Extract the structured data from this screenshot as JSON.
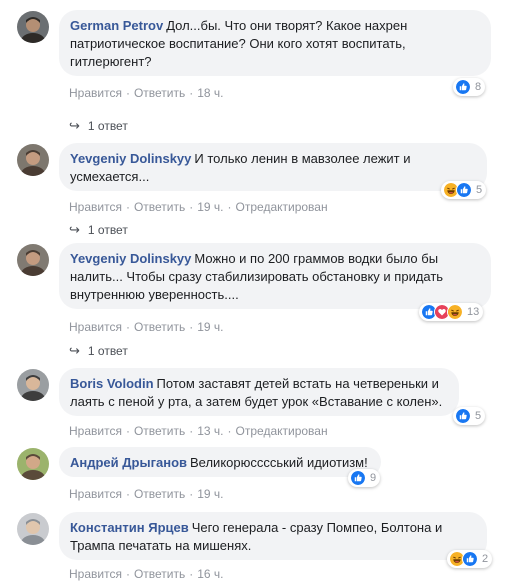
{
  "colors": {
    "link": "#385898",
    "bubble": "#f2f3f5",
    "meta": "#90949c",
    "like": "#1877f2",
    "love": "#e7415a",
    "haha": "#f7b125"
  },
  "comments": [
    {
      "author": "German Petrov",
      "text": "Дол...бы. Что они творят? Какое нахрен патриотическое воспитание? Они кого хотят воспитать, гитлерюгент?",
      "like": "Нравится",
      "reply": "Ответить",
      "time": "18 ч.",
      "edited": "",
      "reactions": [
        "like"
      ],
      "count": "8",
      "replies": "1 ответ"
    },
    {
      "author": "Yevgeniy Dolinskyy",
      "text": "И только ленин в мавзолее лежит и усмехается...",
      "like": "Нравится",
      "reply": "Ответить",
      "time": "19 ч.",
      "edited": "Отредактирован",
      "reactions": [
        "haha",
        "like"
      ],
      "count": "5",
      "replies": "1 ответ"
    },
    {
      "author": "Yevgeniy Dolinskyy",
      "text": "Можно и по 200 граммов водки было бы налить... Чтобы сразу стабилизировать обстановку и придать внутреннюю уверенность....",
      "like": "Нравится",
      "reply": "Ответить",
      "time": "19 ч.",
      "edited": "",
      "reactions": [
        "like",
        "love",
        "haha"
      ],
      "count": "13",
      "replies": "1 ответ"
    },
    {
      "author": "Boris Volodin",
      "text": "Потом заставят детей встать на четвереньки и лаять с пеной у рта, а затем будет урок «Вставание с колен».",
      "like": "Нравится",
      "reply": "Ответить",
      "time": "13 ч.",
      "edited": "Отредактирован",
      "reactions": [
        "like"
      ],
      "count": "5",
      "replies": ""
    },
    {
      "author": "Андрей Дрыганов",
      "text": "Великорюсссський идиотизм!",
      "like": "Нравится",
      "reply": "Ответить",
      "time": "19 ч.",
      "edited": "",
      "reactions": [
        "like"
      ],
      "count": "9",
      "replies": ""
    },
    {
      "author": "Константин Ярцев",
      "text": "Чего генерала - сразу Помпео, Болтона и Трампа печатать на мишенях.",
      "like": "Нравится",
      "reply": "Ответить",
      "time": "16 ч.",
      "edited": "",
      "reactions": [
        "haha",
        "like"
      ],
      "count": "2",
      "replies": ""
    }
  ]
}
